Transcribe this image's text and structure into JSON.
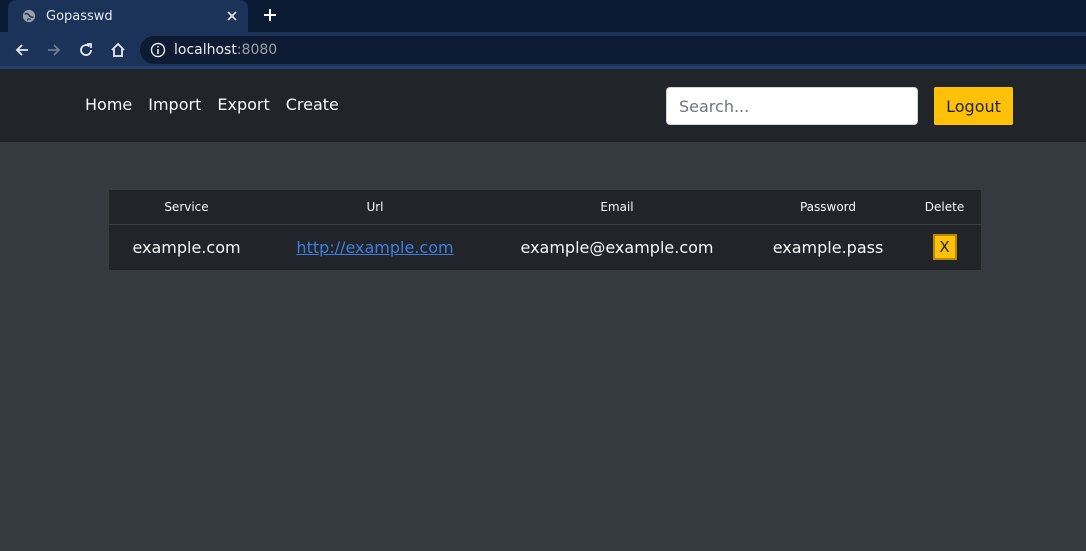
{
  "browser": {
    "tab_title": "Gopasswd",
    "url_host": "localhost",
    "url_port": ":8080"
  },
  "nav": {
    "links": [
      "Home",
      "Import",
      "Export",
      "Create"
    ]
  },
  "search": {
    "placeholder": "Search..."
  },
  "logout_label": "Logout",
  "table": {
    "headers": [
      "Service",
      "Url",
      "Email",
      "Password",
      "Delete"
    ],
    "rows": [
      {
        "service": "example.com",
        "url": "http://example.com",
        "email": "example@example.com",
        "password": "example.pass",
        "delete_label": "X"
      }
    ]
  },
  "colors": {
    "accent": "#ffc107",
    "navbar": "#212529",
    "background": "#343a40",
    "link": "#3d7fe0"
  }
}
